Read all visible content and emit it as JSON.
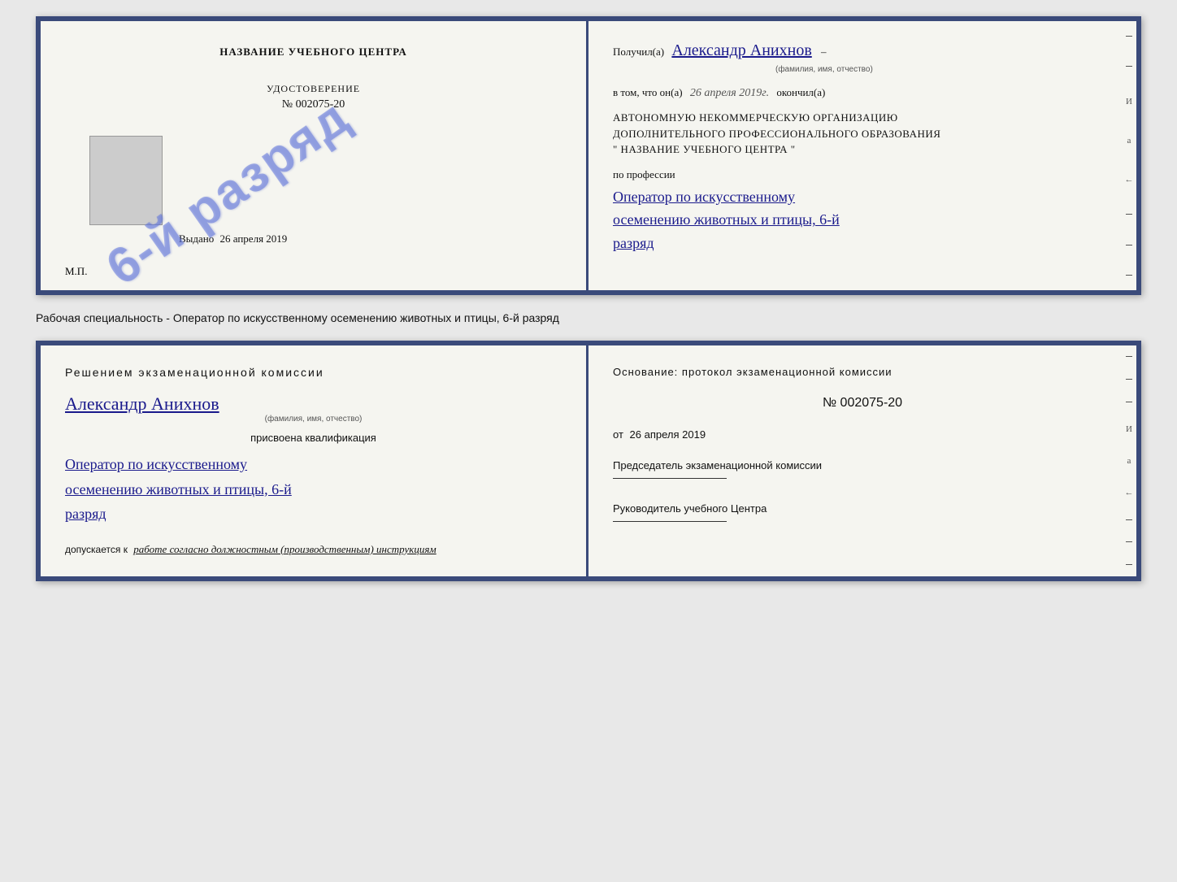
{
  "doc1": {
    "left": {
      "title": "НАЗВАНИЕ УЧЕБНОГО ЦЕНТРА",
      "stamp_text": "6-й разряд",
      "udostoverenie_label": "УДОСТОВЕРЕНИЕ",
      "number": "№ 002075-20",
      "vydano_label": "Выдано",
      "vydano_date": "26 апреля 2019",
      "mp_label": "М.П."
    },
    "right": {
      "poluchil_prefix": "Получил(а)",
      "fio": "Александр Анихнов",
      "fio_small": "(фамилия, имя, отчество)",
      "dash1": "–",
      "vtom_prefix": "в том, что он(а)",
      "vtom_date": "26 апреля 2019г.",
      "okончил": "окончил(а)",
      "org_line1": "АВТОНОМНУЮ НЕКОММЕРЧЕСКУЮ ОРГАНИЗАЦИЮ",
      "org_line2": "ДОПОЛНИТЕЛЬНОГО ПРОФЕССИОНАЛЬНОГО ОБРАЗОВАНИЯ",
      "org_name": "\"  НАЗВАНИЕ УЧЕБНОГО ЦЕНТРА  \"",
      "po_professii": "по профессии",
      "profession_line1": "Оператор по искусственному",
      "profession_line2": "осеменению животных и птицы, 6-й",
      "profession_line3": "разряд"
    }
  },
  "working_specialty": "Рабочая специальность - Оператор по искусственному осеменению животных и птицы, 6-й разряд",
  "doc2": {
    "left": {
      "komissia_text": "Решением  экзаменационной  комиссии",
      "fio": "Александр Анихнов",
      "fio_small": "(фамилия, имя, отчество)",
      "prisvoena": "присвоена квалификация",
      "qual_line1": "Оператор по искусственному",
      "qual_line2": "осеменению животных и птицы, 6-й",
      "qual_line3": "разряд",
      "dopuskaetsya_prefix": "допускается к",
      "dopuskaetsya_text": "работе согласно должностным (производственным) инструкциям"
    },
    "right": {
      "osnovanie_text": "Основание:  протокол  экзаменационной  комиссии",
      "number": "№  002075-20",
      "ot_prefix": "от",
      "ot_date": "26 апреля 2019",
      "predsedatel_label": "Председатель экзаменационной комиссии",
      "rukovoditel_label": "Руководитель учебного Центра"
    }
  },
  "edge": {
    "letters": "И а ←",
    "dashes": [
      "–",
      "–",
      "–",
      "–",
      "–",
      "–",
      "–",
      "–"
    ]
  }
}
